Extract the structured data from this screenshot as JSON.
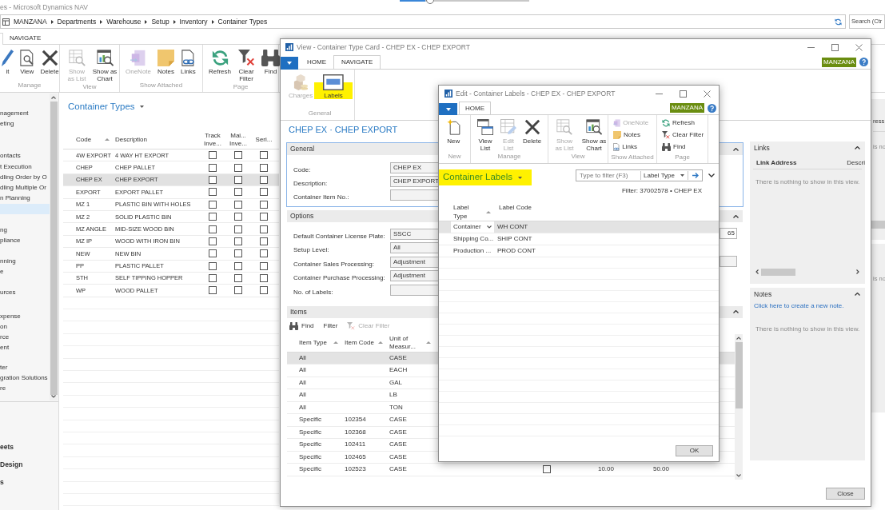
{
  "zoom_slider": {
    "level": 0.2
  },
  "main_window": {
    "title": "es - Microsoft Dynamics NAV",
    "breadcrumb": [
      "MANZANA",
      "Departments",
      "Warehouse",
      "Setup",
      "Inventory",
      "Container Types"
    ],
    "search": {
      "placeholder": "Search (Ctr"
    },
    "tabs": [
      {
        "label": "NAVIGATE",
        "selected": false
      }
    ],
    "ribbon_groups": [
      {
        "label": "Manage",
        "kind": "large",
        "buttons": [
          {
            "label": "it",
            "kind": "edit",
            "disabled": false
          },
          {
            "label": "View",
            "kind": "view",
            "disabled": false
          },
          {
            "label": "Delete",
            "kind": "delete",
            "disabled": false
          }
        ]
      },
      {
        "label": "View",
        "kind": "large",
        "buttons": [
          {
            "label": "Show as List",
            "kind": "list",
            "disabled": true
          },
          {
            "label": "Show as Chart",
            "kind": "chart",
            "disabled": false
          }
        ]
      },
      {
        "label": "Show Attached",
        "kind": "large",
        "buttons": [
          {
            "label": "OneNote",
            "kind": "onenote",
            "disabled": true
          },
          {
            "label": "Notes",
            "kind": "notes",
            "disabled": false
          },
          {
            "label": "Links",
            "kind": "links",
            "disabled": false
          }
        ]
      },
      {
        "label": "Page",
        "kind": "large",
        "buttons": [
          {
            "label": "Refresh",
            "kind": "refresh",
            "disabled": false
          },
          {
            "label": "Clear Filter",
            "kind": "clearfilter",
            "disabled": false
          },
          {
            "label": "Find",
            "kind": "find",
            "disabled": false
          }
        ]
      }
    ],
    "navigation_pane": {
      "groups": [
        [
          {
            "label": "nagement",
            "selected": false
          },
          {
            "label": "eting",
            "selected": false
          }
        ],
        [
          {
            "label": "ontacts",
            "selected": false
          },
          {
            "label": "t Execution",
            "selected": false
          },
          {
            "label": "dling Order by O",
            "selected": false
          },
          {
            "label": "dling Multiple Or",
            "selected": false
          },
          {
            "label": "n Planning",
            "selected": false
          },
          {
            "selected": true
          }
        ],
        [
          {
            "label": "ng",
            "selected": false
          },
          {
            "label": "pliance",
            "selected": false
          }
        ],
        [
          {
            "label": "nning",
            "selected": false
          },
          {
            "label": "e",
            "selected": false
          }
        ],
        [
          {
            "label": "urces",
            "selected": false
          }
        ],
        [
          {
            "label": "xpense",
            "selected": false
          },
          {
            "label": "on",
            "selected": false
          },
          {
            "label": "rce",
            "selected": false
          },
          {
            "label": "ent",
            "selected": false
          }
        ],
        [
          {
            "label": "ter",
            "selected": false
          },
          {
            "label": "gration Solutions",
            "selected": false
          },
          {
            "label": "re",
            "selected": false
          }
        ]
      ],
      "buttons": [
        "eets",
        "Design",
        "s"
      ]
    },
    "list": {
      "title": "Container Types",
      "columns": [
        {
          "label": "Code",
          "sorted": true
        },
        {
          "label": "Description",
          "sorted": false
        },
        {
          "label": "Track Inve...",
          "sorted": false
        },
        {
          "label": "Mai... Inve...",
          "sorted": false
        },
        {
          "label": "Seri...",
          "sorted": false
        }
      ],
      "rows": [
        {
          "code": "4W EXPORT",
          "description": "4 WAY HT EXPORT",
          "checks": [
            false,
            false,
            false
          ],
          "selected": false
        },
        {
          "code": "CHEP",
          "description": "CHEP PALLET",
          "checks": [
            false,
            false,
            false
          ],
          "selected": false
        },
        {
          "code": "CHEP EX",
          "description": "CHEP EXPORT",
          "checks": [
            false,
            false,
            false
          ],
          "selected": true
        },
        {
          "code": "EXPORT",
          "description": "EXPORT PALLET",
          "checks": [
            false,
            false,
            false
          ],
          "selected": false
        },
        {
          "code": "MZ 1",
          "description": "PLASTIC BIN WITH HOLES",
          "checks": [
            false,
            false,
            false
          ],
          "selected": false
        },
        {
          "code": "MZ 2",
          "description": "SOLID PLASTIC BIN",
          "checks": [
            false,
            false,
            false
          ],
          "selected": false
        },
        {
          "code": "MZ ANGLE",
          "description": "MID-SIZE WOOD BIN",
          "checks": [
            false,
            false,
            false
          ],
          "selected": false
        },
        {
          "code": "MZ IP",
          "description": "WOOD WITH IRON BIN",
          "checks": [
            false,
            false,
            false
          ],
          "selected": false
        },
        {
          "code": "NEW",
          "description": "NEW BIN",
          "checks": [
            false,
            false,
            false
          ],
          "selected": false
        },
        {
          "code": "PP",
          "description": "PLASTIC PALLET",
          "checks": [
            false,
            false,
            false
          ],
          "selected": false
        },
        {
          "code": "STH",
          "description": "SELF TIPPING HOPPER",
          "checks": [
            false,
            false,
            false
          ],
          "selected": false
        },
        {
          "code": "WP",
          "description": "WOOD PALLET",
          "checks": [
            false,
            false,
            false
          ],
          "selected": false
        }
      ]
    },
    "factbox_strip": [
      {
        "column": "ress",
        "empty_text": "is no"
      },
      {
        "empty_text": "is no"
      }
    ]
  },
  "card_window": {
    "title": "View - Container Type Card - CHEP EX - CHEP EXPORT",
    "tabs": [
      {
        "label": "HOME",
        "selected": false
      },
      {
        "label": "NAVIGATE",
        "selected": true
      }
    ],
    "company": "MANZANA",
    "ribbon_groups": [
      {
        "label": "General",
        "kind": "large",
        "buttons": [
          {
            "label": "Charges",
            "kind": "charges",
            "disabled": true,
            "highlighted": false
          },
          {
            "label": "Labels",
            "kind": "labels",
            "disabled": false,
            "highlighted": true
          }
        ]
      }
    ],
    "heading": "CHEP EX · CHEP EXPORT",
    "general": {
      "title": "General",
      "expanded": true,
      "focused": true,
      "fields": [
        {
          "label": "Code:",
          "value": "CHEP EX"
        },
        {
          "label": "Description:",
          "value": "CHEP EXPORT"
        },
        {
          "label": "Container Item No.:"
        }
      ]
    },
    "options": {
      "title": "Options",
      "expanded": true,
      "fields": [
        {
          "label": "Default Container License Plate:",
          "value": "SSCC"
        },
        {
          "label": "Setup Level:",
          "value": "All"
        },
        {
          "label": "Container Sales Processing:",
          "value": "Adjustment"
        },
        {
          "label": "Container Purchase Processing:",
          "value": "Adjustment"
        },
        {
          "label": "No. of Labels:"
        }
      ],
      "side_fields": [
        {
          "value": "65",
          "editable": true
        },
        {
          "editable": false
        }
      ]
    },
    "items": {
      "title": "Items",
      "expanded": true,
      "toolbar": [
        {
          "label": "Find",
          "kind": "find",
          "disabled": false
        },
        {
          "label": "Filter",
          "kind": "filter",
          "disabled": false
        },
        {
          "label": "Clear Filter",
          "kind": "clearfilter",
          "disabled": true
        }
      ],
      "columns": [
        {
          "label": "Item Type",
          "sorted": true
        },
        {
          "label": "Item Code",
          "sorted": true
        },
        {
          "label": "Unit of Measur...",
          "sorted": true
        }
      ],
      "rows": [
        {
          "item_type": "All",
          "unit": "CASE",
          "selected": true
        },
        {
          "item_type": "All",
          "unit": "EACH",
          "selected": false
        },
        {
          "item_type": "All",
          "unit": "GAL",
          "selected": false
        },
        {
          "item_type": "All",
          "unit": "LB",
          "selected": false
        },
        {
          "item_type": "All",
          "unit": "TON",
          "selected": false
        },
        {
          "item_type": "Specific",
          "item_code": "102354",
          "unit": "CASE",
          "selected": false
        },
        {
          "item_type": "Specific",
          "item_code": "102368",
          "unit": "CASE",
          "selected": false
        },
        {
          "item_type": "Specific",
          "item_code": "102411",
          "unit": "CASE",
          "selected": false
        },
        {
          "item_type": "Specific",
          "item_code": "102465",
          "unit": "CASE",
          "selected": false
        },
        {
          "item_type": "Specific",
          "item_code": "102523",
          "unit": "CASE",
          "column_4": false,
          "column_5": "10.00",
          "column_6": "50.00",
          "selected": false
        }
      ]
    },
    "factboxes": [
      {
        "title": "Links",
        "expanded": true,
        "columns": [
          "Link Address",
          "Descri"
        ],
        "empty_text": "There is nothing to show in this view."
      },
      {
        "title": "Notes",
        "expanded": true,
        "link": "Click here to create a new note.",
        "empty_text": "There is nothing to show in this view."
      }
    ],
    "close_button": "Close"
  },
  "labels_dialog": {
    "title": "Edit - Container Labels - CHEP EX - CHEP EXPORT",
    "tabs": [
      {
        "label": "HOME",
        "selected": true
      }
    ],
    "company": "MANZANA",
    "ribbon_groups": [
      {
        "label": "New",
        "kind": "large",
        "buttons": [
          {
            "label": "New",
            "kind": "new",
            "disabled": false
          }
        ]
      },
      {
        "label": "Manage",
        "kind": "large",
        "buttons": [
          {
            "label": "View List",
            "kind": "viewlist",
            "disabled": false
          },
          {
            "label": "Edit List",
            "kind": "editlist",
            "disabled": true
          },
          {
            "label": "Delete",
            "kind": "delete",
            "disabled": false
          }
        ]
      },
      {
        "label": "View",
        "kind": "large",
        "buttons": [
          {
            "label": "Show as List",
            "kind": "list",
            "disabled": true
          },
          {
            "label": "Show as Chart",
            "kind": "chart",
            "disabled": false
          }
        ]
      },
      {
        "label": "Show Attached",
        "kind": "small",
        "buttons": [
          {
            "label": "OneNote",
            "kind": "onenote",
            "disabled": true
          },
          {
            "label": "Notes",
            "kind": "notes",
            "disabled": false
          },
          {
            "label": "Links",
            "kind": "links",
            "disabled": false
          }
        ]
      },
      {
        "label": "Page",
        "kind": "small",
        "buttons": [
          {
            "label": "Refresh",
            "kind": "refresh",
            "disabled": false
          },
          {
            "label": "Clear Filter",
            "kind": "clearfilter",
            "disabled": false
          },
          {
            "label": "Find",
            "kind": "find",
            "disabled": false
          }
        ]
      }
    ],
    "heading": "Container Labels",
    "heading_highlighted": true,
    "filter": {
      "placeholder": "Type to filter (F3)",
      "field": "Label Type"
    },
    "filter_text": "Filter: 37002578 • CHEP EX",
    "columns": [
      {
        "label": "Label Type",
        "sorted": true
      },
      {
        "label": "Label Code",
        "sorted": false
      }
    ],
    "rows": [
      {
        "label_type": "Container",
        "label_code": "WH CONT",
        "selected": true
      },
      {
        "label_type": "Shipping Co...",
        "label_code": "SHIP CONT",
        "selected": false
      },
      {
        "label_type": "Production ...",
        "label_code": "PROD CONT",
        "selected": false
      }
    ],
    "ok_button": "OK"
  }
}
